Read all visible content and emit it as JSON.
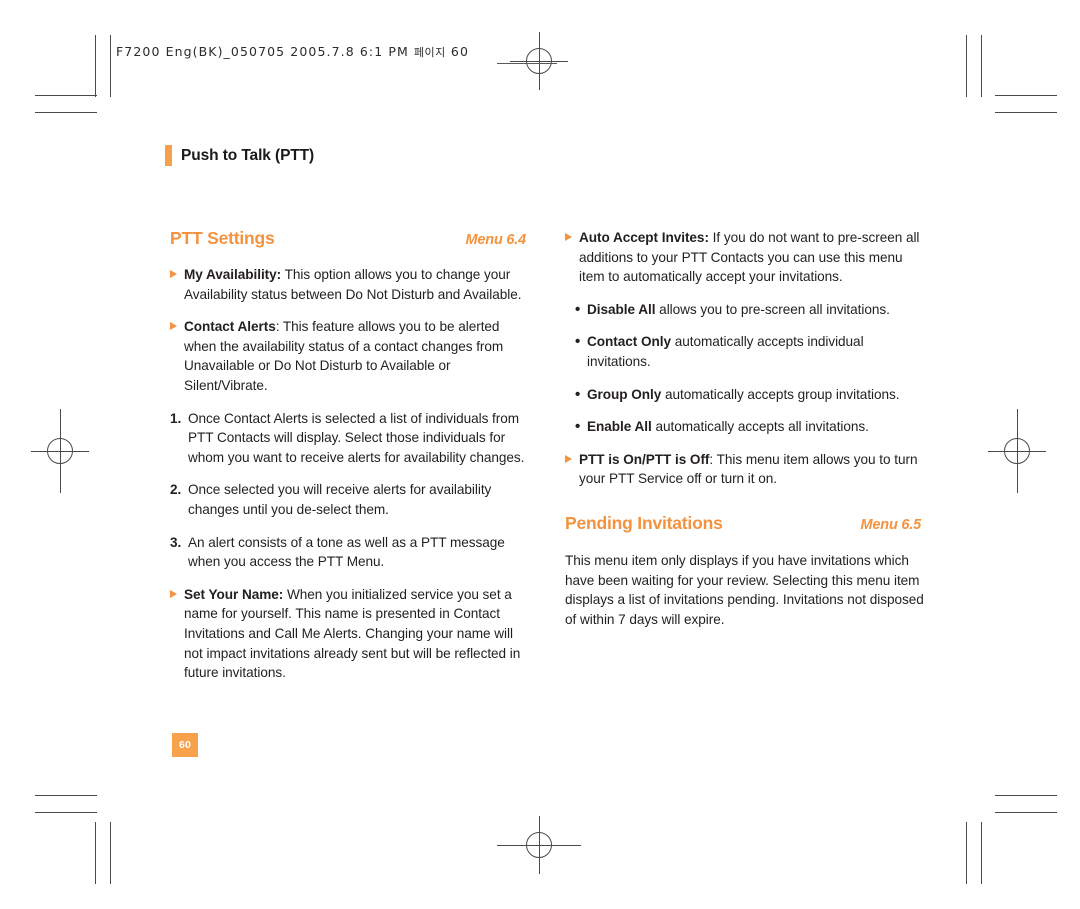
{
  "slug": {
    "text": "F7200 Eng(BK)_050705  2005.7.8  6:1 PM",
    "korean": "페이지",
    "page_ref": "60"
  },
  "running_head": {
    "label": "Push to Talk (PTT)"
  },
  "folio": {
    "page_number": "60"
  },
  "colors": {
    "accent_orange": "#f5923e",
    "folio_orange": "#f7a14c",
    "body_text": "#231f20",
    "mark_gray": "#4a4a4a"
  },
  "left_column": {
    "section": {
      "title": "PTT Settings",
      "menu": "Menu 6.4"
    },
    "paragraphs": [
      {
        "kind": "triangle",
        "lead": "My Availability:",
        "text": " This option allows you to change your Availability status between Do Not Disturb and Available."
      },
      {
        "kind": "triangle",
        "lead": "Contact Alerts",
        "text": ": This feature allows you to be alerted when the availability status of a contact changes from Unavailable or Do Not Disturb to Available or Silent/Vibrate."
      },
      {
        "kind": "number",
        "marker": "1.",
        "text": "Once Contact Alerts is selected a list of individuals from PTT Contacts will display. Select those individuals for whom you want to receive alerts for availability changes."
      },
      {
        "kind": "number",
        "marker": "2.",
        "text": "Once selected you will receive alerts for availability changes until you de-select them."
      },
      {
        "kind": "number",
        "marker": "3.",
        "text": "An alert consists of a tone as well as a PTT message when you access the PTT Menu."
      },
      {
        "kind": "triangle",
        "lead": "Set Your Name:",
        "text": " When you initialized service you set a name for yourself. This name is presented in Contact Invitations and Call Me Alerts.  Changing your name will not impact invitations already sent but will be reflected in future invitations."
      }
    ]
  },
  "right_column": {
    "paragraphs": [
      {
        "kind": "triangle",
        "lead": "Auto Accept Invites:",
        "text": " If you do not want to pre-screen all additions to your PTT Contacts you can use this menu item to automatically accept your invitations."
      },
      {
        "kind": "dot",
        "marker": "•",
        "lead": "Disable All",
        "text": " allows you to pre-screen all invitations."
      },
      {
        "kind": "dot",
        "marker": "•",
        "lead": "Contact Only",
        "text": " automatically accepts individual invitations."
      },
      {
        "kind": "dot",
        "marker": "•",
        "lead": "Group Only",
        "text": " automatically accepts group invitations."
      },
      {
        "kind": "dot",
        "marker": "•",
        "lead": "Enable All",
        "text": " automatically accepts all invitations."
      },
      {
        "kind": "triangle",
        "lead": "PTT is On/PTT is Off",
        "text": ": This menu item allows you to turn your PTT Service off or turn it on."
      }
    ],
    "section": {
      "title": "Pending Invitations",
      "menu": "Menu 6.5"
    },
    "body": "This menu item only displays if you have invitations which have been waiting for your review. Selecting this menu item displays a list of invitations pending. Invitations not disposed of within 7 days will expire."
  }
}
